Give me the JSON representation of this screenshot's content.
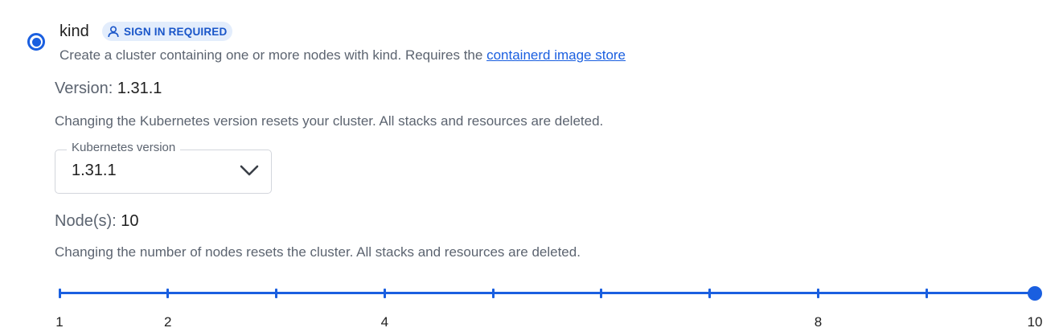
{
  "option": {
    "title": "kind",
    "selected": true,
    "badge": "SIGN IN REQUIRED",
    "badge_icon": "person-icon",
    "description_prefix": "Create a cluster containing one or more nodes with kind. Requires the ",
    "description_link": "containerd image store"
  },
  "version": {
    "label": "Version:",
    "value": "1.31.1",
    "help": "Changing the Kubernetes version resets your cluster. All stacks and resources are deleted.",
    "select_label": "Kubernetes version",
    "select_value": "1.31.1",
    "chevron_icon": "chevron-down-icon"
  },
  "nodes": {
    "label": "Node(s):",
    "value": "10",
    "help": "Changing the number of nodes resets the cluster. All stacks and resources are deleted.",
    "slider": {
      "min": 1,
      "max": 10,
      "step": 1,
      "value": 10,
      "tick_labels": [
        "1",
        "2",
        "4",
        "8",
        "10"
      ]
    }
  },
  "colors": {
    "accent": "#1a5fe0",
    "badge_bg": "#e3edfc",
    "muted_text": "#5c6470"
  }
}
